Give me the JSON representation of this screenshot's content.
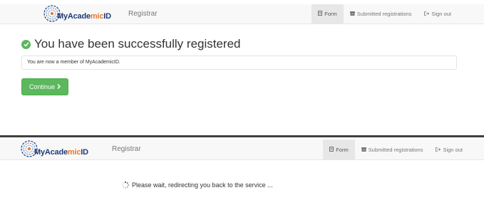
{
  "top": {
    "logo": {
      "part1": "MyAcade",
      "part2": "mic",
      "part3": "ID"
    },
    "brand": "Registrar",
    "nav": [
      {
        "label": "Form",
        "icon": "file-icon",
        "active": true
      },
      {
        "label": "Submitted registrations",
        "icon": "archive-icon",
        "active": false
      },
      {
        "label": "Sign out",
        "icon": "sign-out-icon",
        "active": false
      }
    ],
    "success_title": "You have been successfully registered",
    "message": "You are now a member of MyAcademicID.",
    "continue_label": "Continue"
  },
  "bottom": {
    "logo": {
      "part1": "MyAcade",
      "part2": "mic",
      "part3": "ID"
    },
    "brand": "Registrar",
    "nav": [
      {
        "label": "Form",
        "icon": "file-icon",
        "active": true
      },
      {
        "label": "Submitted registrations",
        "icon": "archive-icon",
        "active": false
      },
      {
        "label": "Sign out",
        "icon": "sign-out-icon",
        "active": false
      }
    ],
    "wait_message": "Please wait, redirecting you back to the service ..."
  },
  "colors": {
    "success": "#5cb85c",
    "logo_blue": "#1f3c78",
    "logo_orange": "#e8772e"
  }
}
